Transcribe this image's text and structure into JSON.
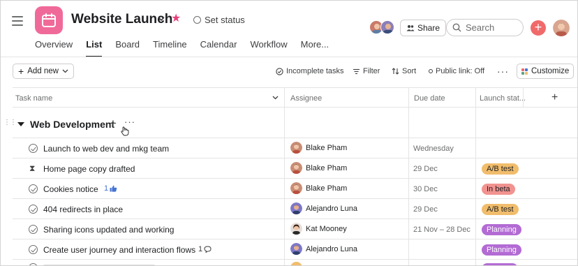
{
  "project": {
    "title": "Website Launch",
    "set_status_label": "Set status",
    "icon": "calendar-icon",
    "icon_color": "#f06a99"
  },
  "header": {
    "share_label": "Share",
    "search_placeholder": "Search"
  },
  "tabs": [
    {
      "label": "Overview"
    },
    {
      "label": "List",
      "active": true
    },
    {
      "label": "Board"
    },
    {
      "label": "Timeline"
    },
    {
      "label": "Calendar"
    },
    {
      "label": "Workflow"
    },
    {
      "label": "More..."
    }
  ],
  "toolbar": {
    "add_new_label": "Add new",
    "incomplete_tasks_label": "Incomplete tasks",
    "filter_label": "Filter",
    "sort_label": "Sort",
    "public_link_label": "Public link: Off",
    "customize_label": "Customize"
  },
  "columns": {
    "task_name": "Task name",
    "assignee": "Assignee",
    "due_date": "Due date",
    "launch_status": "Launch stat..."
  },
  "section": {
    "title": "Web Development"
  },
  "rows": [
    {
      "task": "Launch to web dev and mkg team",
      "icon": "check-circle-icon",
      "assignee": "Blake Pham",
      "due": "Wednesday",
      "status": "",
      "meta": ""
    },
    {
      "task": "Home page copy drafted",
      "icon": "hourglass-icon",
      "assignee": "Blake Pham",
      "due": "29 Dec",
      "status": "A/B test",
      "meta": ""
    },
    {
      "task": "Cookies notice",
      "icon": "check-circle-icon",
      "assignee": "Blake Pham",
      "due": "30 Dec",
      "status": "In beta",
      "meta": "1"
    },
    {
      "task": "404 redirects in place",
      "icon": "check-circle-icon",
      "assignee": "Alejandro Luna",
      "due": "29 Dec",
      "status": "A/B test",
      "meta": ""
    },
    {
      "task": "Sharing icons updated and working",
      "icon": "check-circle-icon",
      "assignee": "Kat Mooney",
      "due": "21 Nov – 28 Dec",
      "status": "Planning",
      "meta": ""
    },
    {
      "task": "Create user journey and interaction flows",
      "icon": "check-circle-icon",
      "assignee": "Alejandro Luna",
      "due": "",
      "status": "Planning",
      "meta": "1"
    }
  ],
  "status_colors": {
    "A/B test": "#f1bd6c",
    "In beta": "#f19390",
    "Planning": "#b36bd4"
  },
  "accent_color": "#f06a6a"
}
